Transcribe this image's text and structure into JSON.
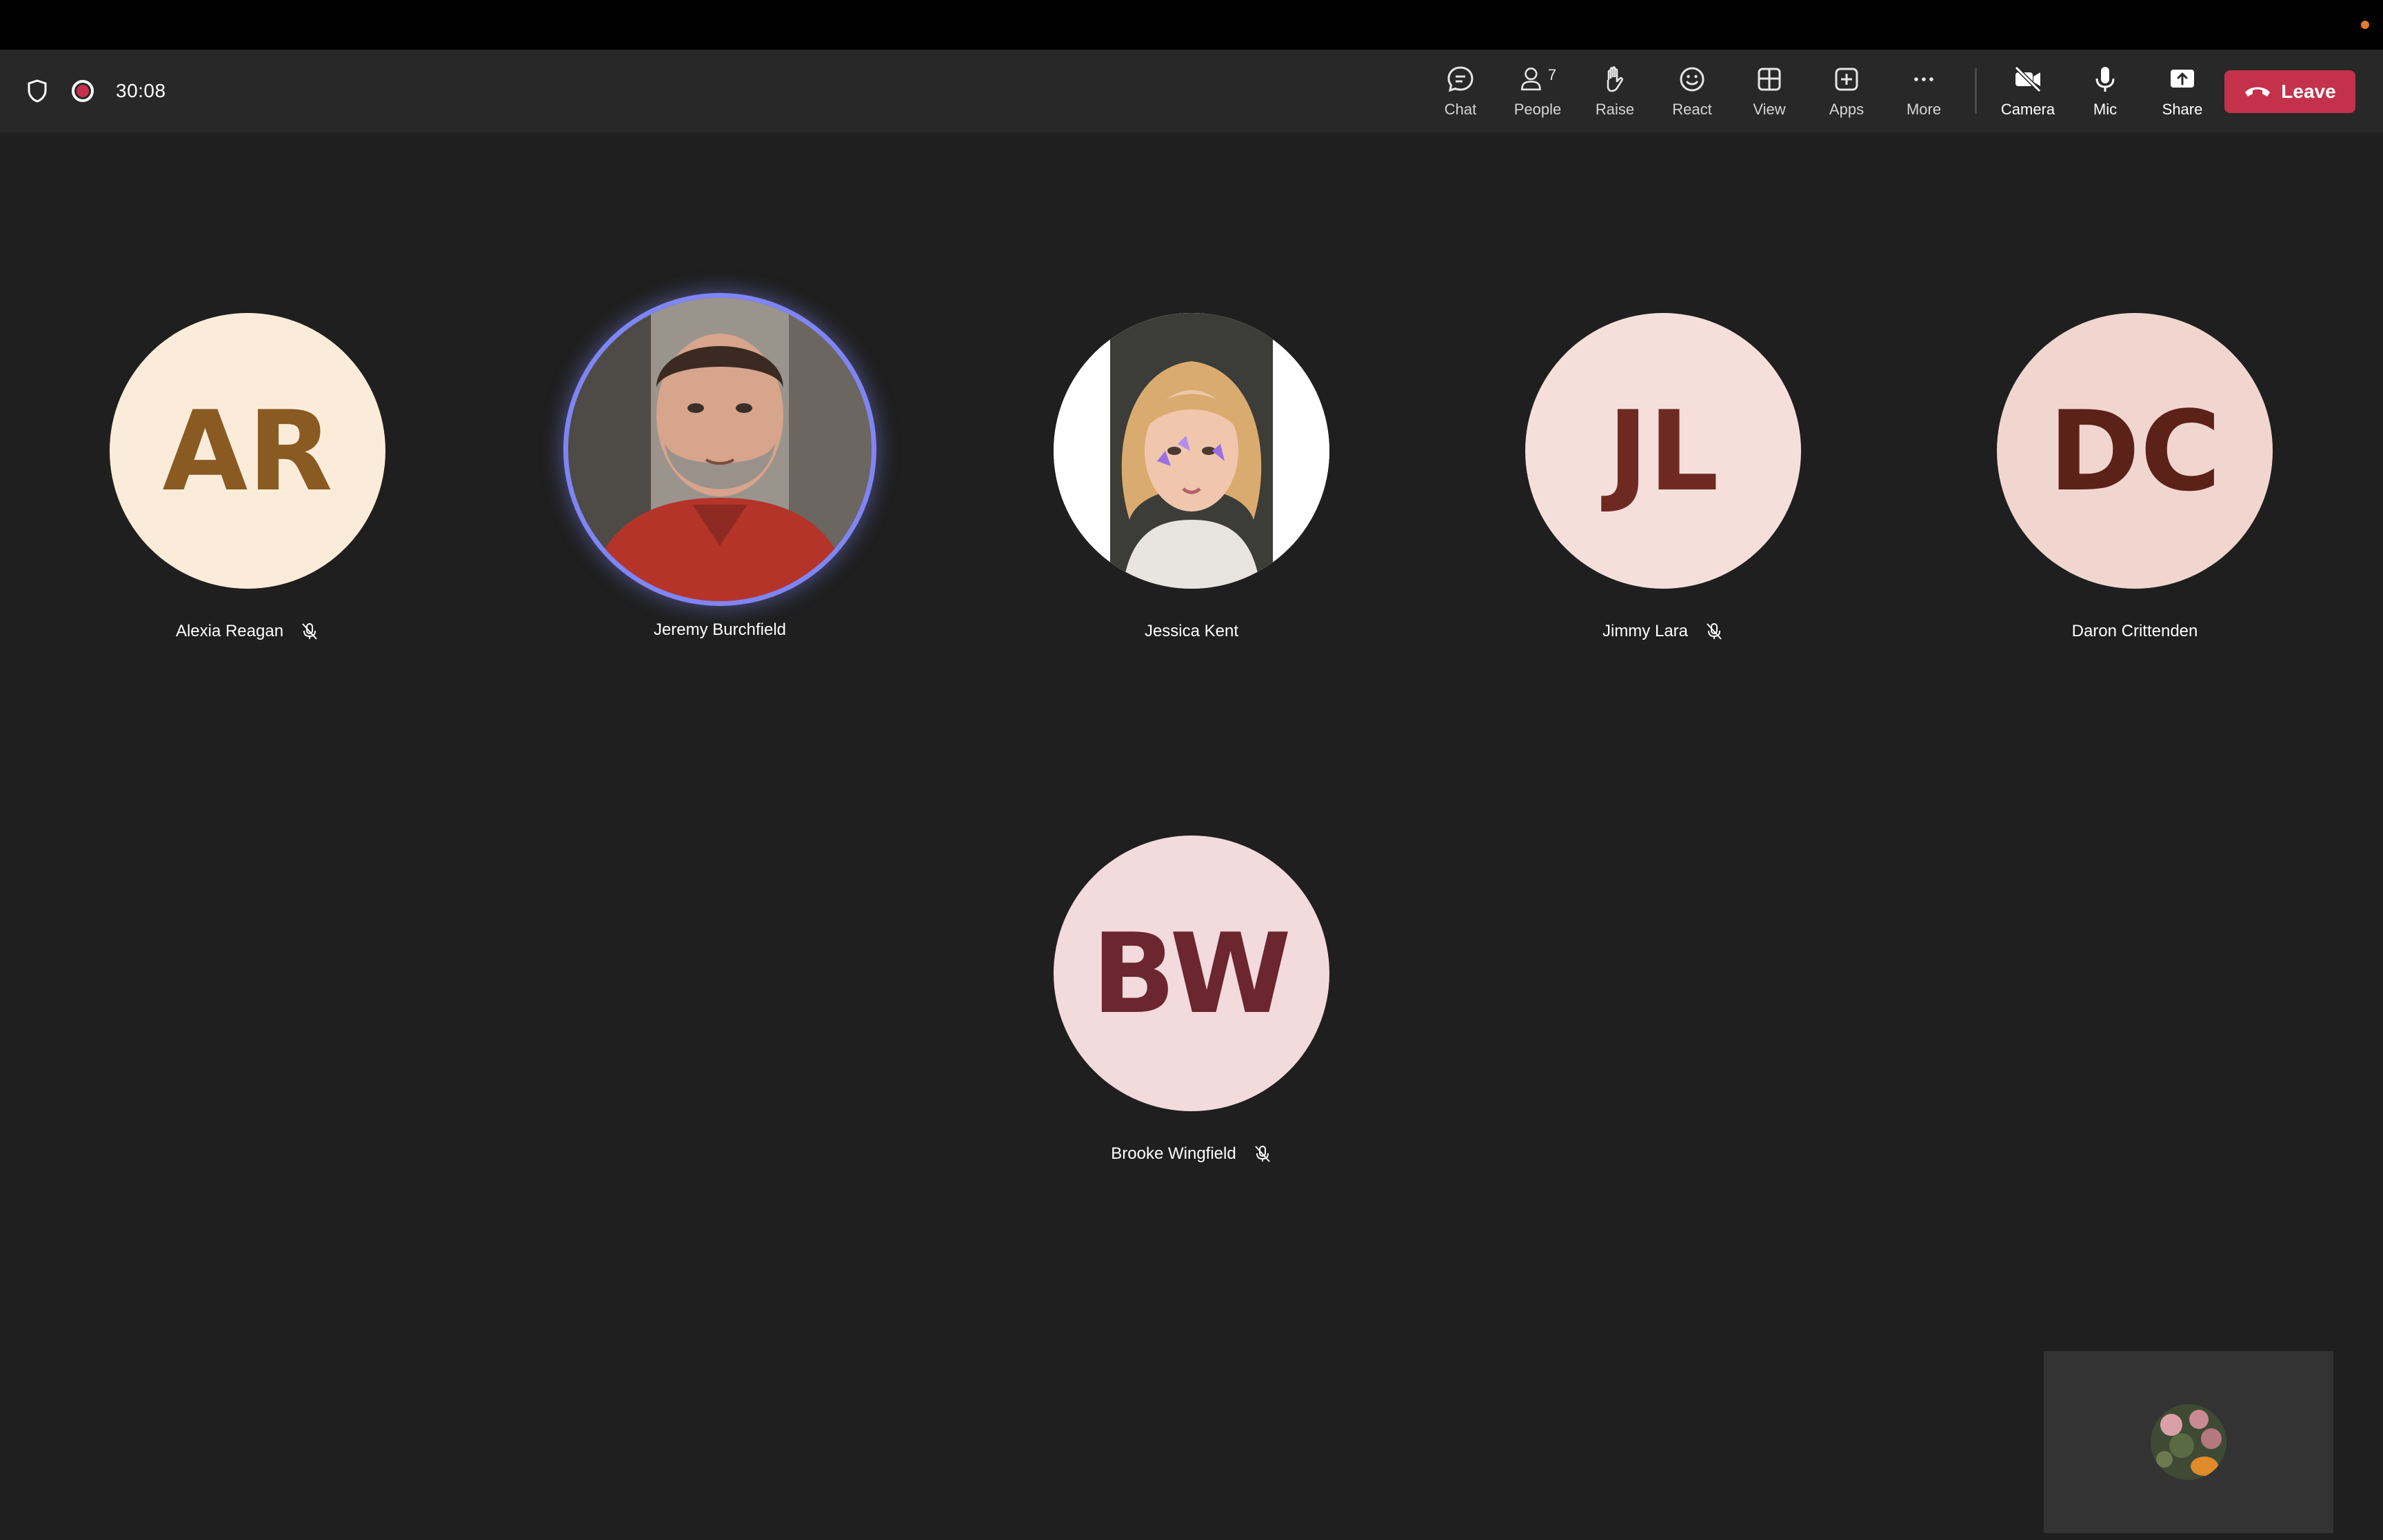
{
  "meeting": {
    "timer": "30:08"
  },
  "toolbar": {
    "chat": "Chat",
    "people": "People",
    "people_count": "7",
    "raise": "Raise",
    "react": "React",
    "view": "View",
    "apps": "Apps",
    "more": "More",
    "camera": "Camera",
    "mic": "Mic",
    "share": "Share",
    "leave": "Leave"
  },
  "colors": {
    "leave": "#c4314b",
    "speaking_ring": "#7f85f5",
    "background": "#1f1f1f"
  },
  "participants": [
    {
      "name": "Alexia Reagan",
      "initials": "AR",
      "muted": true
    },
    {
      "name": "Jeremy Burchfield",
      "initials": "",
      "muted": false,
      "speaking": true,
      "video": true
    },
    {
      "name": "Jessica Kent",
      "initials": "",
      "muted": false,
      "video": true
    },
    {
      "name": "Jimmy Lara",
      "initials": "JL",
      "muted": true
    },
    {
      "name": "Daron Crittenden",
      "initials": "DC",
      "muted": false
    },
    {
      "name": "Brooke Wingfield",
      "initials": "BW",
      "muted": true
    }
  ]
}
